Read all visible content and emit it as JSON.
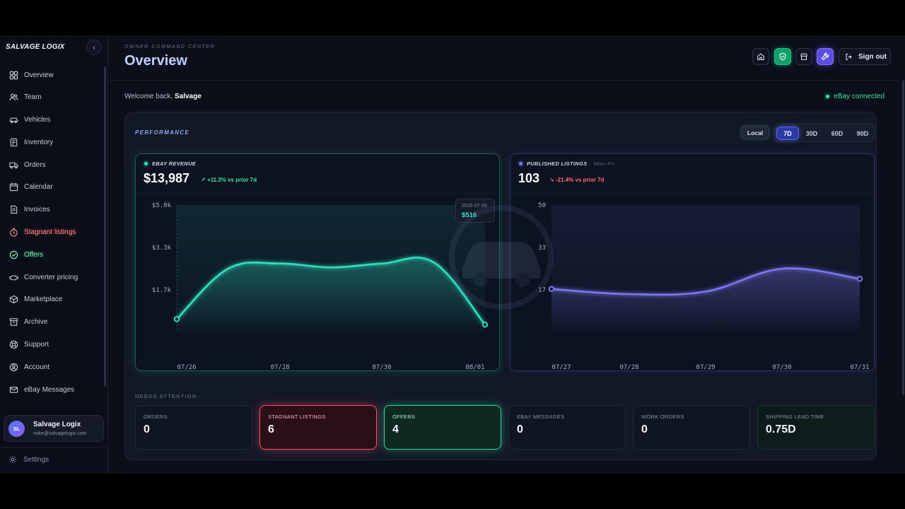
{
  "sidebar": {
    "brand": "SALVAGE LOGIX",
    "collapse_icon": "‹",
    "items": [
      {
        "label": "Overview",
        "icon": "grid-icon",
        "state": "active"
      },
      {
        "label": "Team",
        "icon": "users-icon",
        "state": "normal"
      },
      {
        "label": "Vehicles",
        "icon": "car-icon",
        "state": "normal"
      },
      {
        "label": "Inventory",
        "icon": "inventory-icon",
        "state": "normal"
      },
      {
        "label": "Orders",
        "icon": "truck-icon",
        "state": "normal"
      },
      {
        "label": "Calendar",
        "icon": "calendar-icon",
        "state": "normal"
      },
      {
        "label": "Invoices",
        "icon": "invoice-icon",
        "state": "normal"
      },
      {
        "label": "Stagnant listings",
        "icon": "timer-icon",
        "state": "warn"
      },
      {
        "label": "Offers",
        "icon": "check-circle-icon",
        "state": "good"
      },
      {
        "label": "Converter pricing",
        "icon": "converter-icon",
        "state": "normal"
      },
      {
        "label": "Marketplace",
        "icon": "box-icon",
        "state": "normal"
      },
      {
        "label": "Archive",
        "icon": "archive-icon",
        "state": "normal"
      },
      {
        "label": "Support",
        "icon": "lifebuoy-icon",
        "state": "normal"
      },
      {
        "label": "Account",
        "icon": "account-icon",
        "state": "normal"
      },
      {
        "label": "eBay Messages",
        "icon": "mail-icon",
        "state": "normal"
      }
    ],
    "user": {
      "initials": "SL",
      "name": "Salvage Logix",
      "email": "mike@salvagelogix.com"
    },
    "settings_label": "Settings"
  },
  "header": {
    "eyebrow": "OWNER COMMAND CENTER",
    "title": "Overview",
    "sign_out": "Sign out"
  },
  "welcome": {
    "prefix": "Welcome back,",
    "name": "Salvage"
  },
  "ebay_status": "eBay connected",
  "performance": {
    "label": "PERFORMANCE",
    "local_label": "Local",
    "ranges": [
      {
        "label": "7D",
        "active": true
      },
      {
        "label": "30D",
        "active": false
      },
      {
        "label": "60D",
        "active": false
      },
      {
        "label": "90D",
        "active": false
      }
    ]
  },
  "colors": {
    "teal": "#2fe0c0",
    "violet": "#7a78f0",
    "red": "#ff4d68",
    "green": "#34d79a"
  },
  "chart_data": [
    {
      "type": "area",
      "title": "EBAY REVENUE",
      "value": "$13,987",
      "delta": "+11.3% vs prior 7d",
      "delta_direction": "up",
      "y_ticks": [
        "$5.0k",
        "$3.3k",
        "$1.7k"
      ],
      "ylim": [
        0,
        5000
      ],
      "x_ticks": [
        "07/26",
        "07/28",
        "07/30",
        "08/01"
      ],
      "x": [
        "07/26",
        "07/27",
        "07/28",
        "07/29",
        "07/30",
        "07/31",
        "08/01"
      ],
      "values": [
        516,
        2500,
        2700,
        2550,
        2700,
        2750,
        300
      ],
      "tooltip": {
        "date": "2026-07-26",
        "value": "$516"
      }
    },
    {
      "type": "area",
      "title": "PUBLISHED LISTINGS",
      "subtitle": "· Mon–Fri",
      "value": "103",
      "delta": "-21.4% vs prior 7d",
      "delta_direction": "down",
      "y_ticks": [
        "50",
        "33",
        "17"
      ],
      "ylim": [
        0,
        50
      ],
      "x_ticks": [
        "07/27",
        "07/28",
        "07/29",
        "07/30",
        "07/31"
      ],
      "x": [
        "07/27",
        "07/28",
        "07/29",
        "07/30",
        "07/31"
      ],
      "values": [
        17,
        15,
        16,
        25,
        21
      ]
    }
  ],
  "needs_attention": {
    "label": "NEEDS ATTENTION",
    "stats": [
      {
        "label": "ORDERS",
        "value": "0",
        "tone": "normal"
      },
      {
        "label": "STAGNANT LISTINGS",
        "value": "6",
        "tone": "red"
      },
      {
        "label": "OFFERS",
        "value": "4",
        "tone": "green"
      },
      {
        "label": "EBAY MESSAGES",
        "value": "0",
        "tone": "normal"
      },
      {
        "label": "WORK ORDERS",
        "value": "0",
        "tone": "normal"
      },
      {
        "label": "SHIPPING LEAD TIME",
        "value": "0.75D",
        "tone": "teal-dim"
      }
    ]
  }
}
